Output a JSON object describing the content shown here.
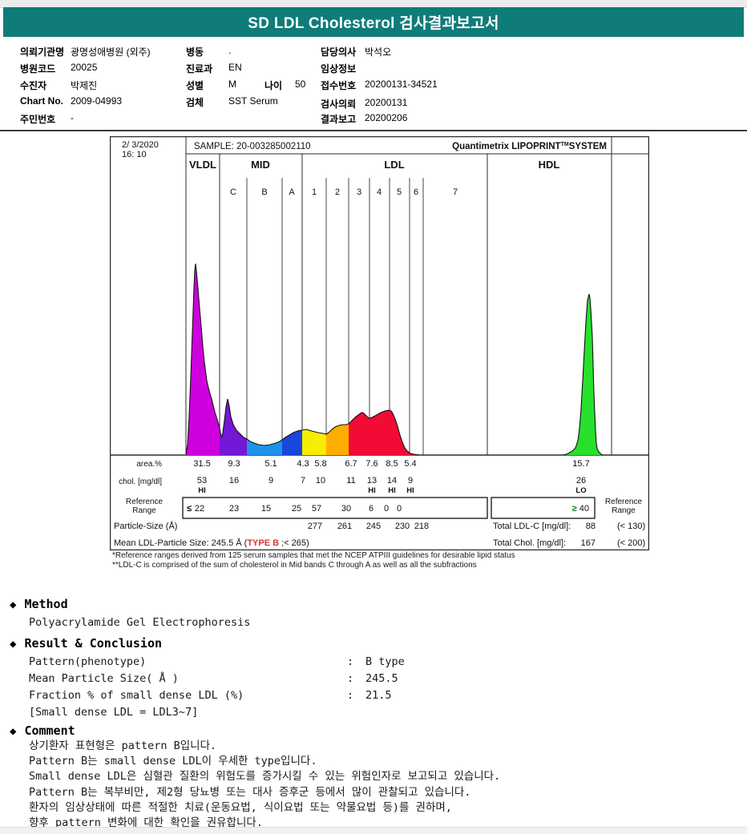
{
  "title": "SD LDL Cholesterol 검사결과보고서",
  "patient_info": {
    "col1": [
      {
        "label": "의뢰기관명",
        "value": "광명성애병원 (외주)"
      },
      {
        "label": "병원코드",
        "value": "20025"
      },
      {
        "label": "수진자",
        "value": "박제진"
      },
      {
        "label": "Chart No.",
        "value": "2009-04993"
      },
      {
        "label": "주민번호",
        "value": "-"
      }
    ],
    "col2": [
      {
        "label": "병동",
        "value": "."
      },
      {
        "label": "진료과",
        "value": "EN"
      },
      {
        "label": "성별",
        "value": "M",
        "label2": "나이",
        "value2": "50"
      },
      {
        "label": "검체",
        "value": "SST Serum"
      }
    ],
    "col3": [
      {
        "label": "담당의사",
        "value": "박석오"
      },
      {
        "label": "임상정보",
        "value": ""
      },
      {
        "label": "접수번호",
        "value": "20200131-34521"
      },
      {
        "label": "검사의뢰",
        "value": "20200131"
      },
      {
        "label": "결과보고",
        "value": "20200206"
      }
    ]
  },
  "chart": {
    "datetime_line1": "2/ 3/2020",
    "datetime_line2": "16: 10",
    "sample_label": "SAMPLE:  20-003285002110",
    "brand_1": "Quantimetrix LIPOPRINT",
    "brand_tm": "TM",
    "brand_2": "SYSTEM",
    "groups": [
      "VLDL",
      "MID",
      "LDL",
      "HDL"
    ],
    "subbands": [
      "C",
      "B",
      "A",
      "1",
      "2",
      "3",
      "4",
      "5",
      "6",
      "7"
    ],
    "rows": {
      "area_label": "area.%",
      "area_values": [
        "31.5",
        "9.3",
        "5.1",
        "4.3",
        "5.8",
        "6.7",
        "7.6",
        "8.5",
        "5.4"
      ],
      "area_hdl": "15.7",
      "chol_label": "chol. [mg/dl]",
      "chol_values": [
        "53",
        "16",
        "9",
        "7",
        "10",
        "11",
        "13",
        "14",
        "9"
      ],
      "chol_flag_1": "HI",
      "chol_flag_7": "HI",
      "chol_flag_8": "HI",
      "chol_flag_9": "HI",
      "chol_hdl": "26",
      "chol_hdl_flag": "LO",
      "ref_label_1": "Reference",
      "ref_label_2": "Range",
      "ref_lte": "≤",
      "ref_values": [
        "22",
        "23",
        "15",
        "25",
        "57",
        "30",
        "6",
        "0",
        "0"
      ],
      "ref_gte_sign": "≥",
      "ref_gte_value": " 40",
      "particle_label": "Particle-Size (Å)",
      "particle_values": [
        "277",
        "261",
        "245",
        "230",
        "218"
      ],
      "total_ldl_label": "Total LDL-C [mg/dl]:",
      "total_ldl_value": "88",
      "total_ldl_ref": "(< 130)",
      "mean_prefix": "Mean LDL-Particle Size:  245.5 Å (",
      "mean_type": "TYPE B",
      "mean_suffix": " ;< 265)",
      "total_chol_label": "Total Chol. [mg/dl]:",
      "total_chol_value": "167",
      "total_chol_ref": "(< 200)"
    },
    "footnote1": "*Reference ranges derived from 125 serum samples that met the NCEP ATPIII guidelines for desirable lipid status",
    "footnote2": "**LDL-C is comprised of the sum of cholesterol in Mid bands C through A as well as all the subfractions"
  },
  "chart_data": {
    "type": "area",
    "title": "Quantimetrix LIPOPRINT SYSTEM lipoprotein electrophoresis profile",
    "bands": [
      "VLDL",
      "MID C",
      "MID B",
      "MID A",
      "LDL1",
      "LDL2",
      "LDL3",
      "LDL4",
      "LDL5",
      "LDL6",
      "LDL7",
      "HDL"
    ],
    "area_percent": [
      31.5,
      9.3,
      5.1,
      4.3,
      5.8,
      6.7,
      7.6,
      8.5,
      5.4,
      null,
      null,
      15.7
    ],
    "chol_mg_dl": [
      53,
      16,
      9,
      7,
      10,
      11,
      13,
      14,
      9,
      null,
      null,
      26
    ],
    "flags": [
      "HI",
      "",
      "",
      "",
      "",
      "",
      "HI",
      "HI",
      "HI",
      "",
      "",
      "LO"
    ],
    "reference_range": [
      "≤22",
      "23",
      "15",
      "25",
      "57",
      "30",
      "6",
      "0",
      "0",
      "",
      "",
      "≥40"
    ],
    "particle_size_A": [
      null,
      null,
      null,
      null,
      277,
      261,
      245,
      230,
      218,
      null,
      null,
      null
    ],
    "totals": {
      "total_ldl_c": 88,
      "total_chol": 167,
      "mean_ldl_particle_size": 245.5,
      "pattern": "TYPE B"
    }
  },
  "colors": {
    "teal": "#0f7c7a",
    "brand_magenta": "#ee00ee",
    "vldl": "#cf00dd",
    "mid_c": "#7517d6",
    "mid_b": "#1f93ea",
    "mid_a": "#1a46dd",
    "ldl1": "#f8ec00",
    "ldl2": "#ffae00",
    "ldl3": "#f20b35",
    "hdl": "#27e02c",
    "flag_red": "#e03030",
    "lte_red": "#dd2222",
    "gte_green": "#1a8833"
  },
  "method": {
    "heading": "Method",
    "body": "Polyacrylamide Gel Electrophoresis"
  },
  "result": {
    "heading": "Result & Conclusion",
    "rows": [
      {
        "label": "Pattern(phenotype)",
        "colon": ":",
        "value": "B type"
      },
      {
        "label": "Mean Particle Size( Å )",
        "colon": ":",
        "value": "245.5"
      },
      {
        "label": "Fraction % of small dense LDL (%)",
        "colon": ":",
        "value": "21.5"
      }
    ],
    "note": "[Small dense LDL = LDL3~7]"
  },
  "comment": {
    "heading": "Comment",
    "lines": [
      "상기환자 표현형은 pattern B입니다.",
      "Pattern B는 small dense LDL이 우세한 type입니다.",
      "Small dense LDL은 심혈관 질환의 위험도를 증가시킬 수 있는 위험인자로 보고되고 있습니다.",
      "Pattern B는 복부비만, 제2형 당뇨병 또는 대사 증후군 등에서 많이 관찰되고 있습니다.",
      "환자의 임상상태에 따른 적절한 치료(운동요법, 식이요법 또는 약물요법 등)를 권하며,",
      "향후 pattern 변화에 대한 확인을 권유합니다."
    ]
  }
}
